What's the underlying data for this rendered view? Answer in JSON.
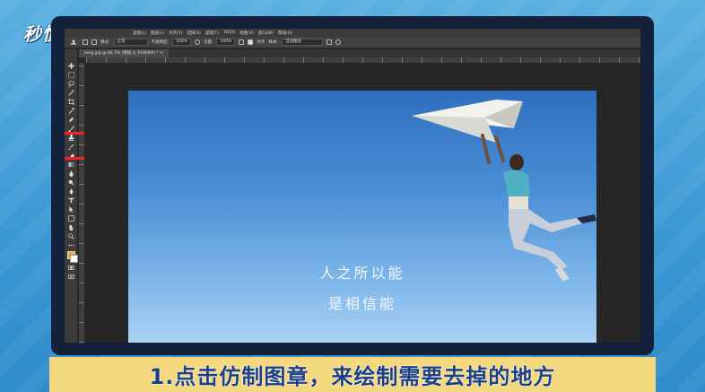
{
  "brand": {
    "logo_text": "秒懂视频"
  },
  "menubar": {
    "items": [
      "滤镜(L)",
      "图层(L)",
      "文字(Y)",
      "选择(S)",
      "滤镜(T)",
      "3D(D)",
      "视图(V)",
      "窗口(W)",
      "帮助(H)"
    ]
  },
  "options": {
    "mode_label": "模式:",
    "mode_value": "正常",
    "opacity_label": "不透明度:",
    "opacity_value": "100%",
    "flow_label": "流量:",
    "flow_value": "100%",
    "align_label": "对齐",
    "sample_label": "样本:",
    "sample_value": "当前图层"
  },
  "document": {
    "tab_title": "tong.jpg @ 66.7% (图层 0, RGB/8#) *  ×"
  },
  "image": {
    "quote_line1": "人之所以能",
    "quote_line2": "是相信能"
  },
  "caption": {
    "text": "1.点击仿制图章，来绘制需要去掉的地方"
  },
  "colors": {
    "highlight": "#ff1f1f",
    "caption_bg": "#f4d87e",
    "caption_text": "#1d3e80"
  }
}
